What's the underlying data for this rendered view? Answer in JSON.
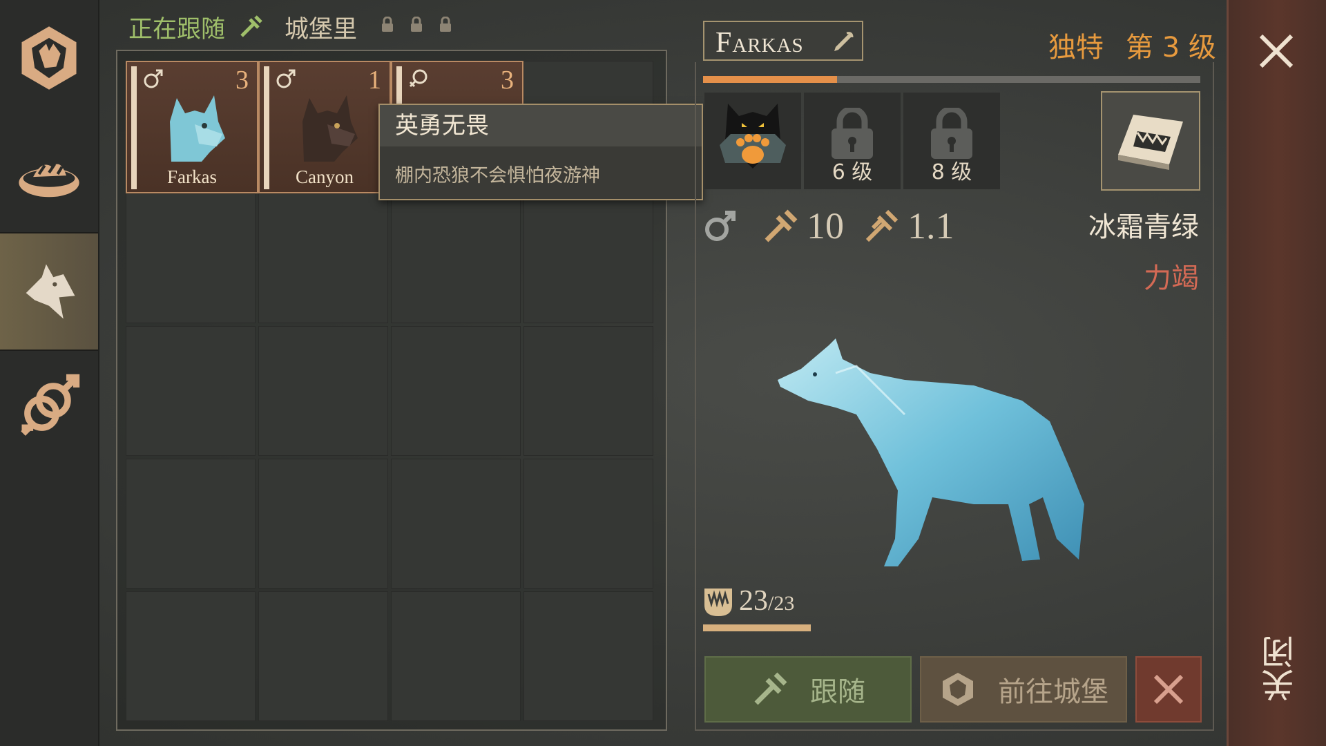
{
  "tabs": {
    "following": "正在跟随",
    "castle": "城堡里"
  },
  "sidebar": {
    "items": [
      {
        "name": "wolf-crest",
        "active": false
      },
      {
        "name": "food-bowl",
        "active": false
      },
      {
        "name": "wolf-profile",
        "active": true
      },
      {
        "name": "breeding",
        "active": false
      }
    ]
  },
  "slots": [
    {
      "name": "Farkas",
      "level": "3",
      "gender": "male",
      "coat": "#7fc7d6"
    },
    {
      "name": "Canyon",
      "level": "1",
      "gender": "male",
      "coat": "#3b2c25"
    },
    {
      "name": "",
      "level": "3",
      "gender": "female",
      "coat": "#3b2c25"
    }
  ],
  "tooltip": {
    "title": "英勇无畏",
    "description": "棚内恐狼不会惧怕夜游神"
  },
  "wolf": {
    "name": "Farkas",
    "rarity": "独特",
    "level_label": "第 3 级",
    "xp_progress": 0.27,
    "skill_slots": [
      {
        "locked": false,
        "icon": "paw-skill-icon"
      },
      {
        "locked": true,
        "unlock_label": "6 级"
      },
      {
        "locked": true,
        "unlock_label": "8 级"
      }
    ],
    "gender": "male",
    "attack": "10",
    "speed": "1.1",
    "color_name": "冰霜青绿",
    "state": "力竭",
    "hunger_value": "23",
    "hunger_max": "/23",
    "hunger_progress": 1.0
  },
  "buttons": {
    "follow": "跟随",
    "go_castle": "前往城堡"
  },
  "close": {
    "label": "关闭"
  },
  "colors": {
    "accent_orange": "#e79a3e",
    "state_red": "#d46a55",
    "follow_green": "#4d5a3a",
    "close_red": "#5b362b"
  }
}
